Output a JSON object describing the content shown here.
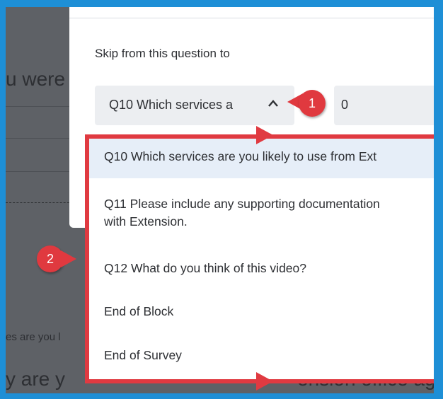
{
  "background": {
    "snippet_top": "u were",
    "snippet_middle": "es are you l",
    "snippet_bottom": "y are y",
    "snippet_bottom_right": "ension office aga"
  },
  "modal": {
    "skip_label": "Skip from this question to",
    "select_value": "Q10 Which services a",
    "second_field_value": "0"
  },
  "dropdown": {
    "items": [
      {
        "label": "Q10 Which services are you likely to use from Ext"
      },
      {
        "label": "Q11 Please include any supporting documentation",
        "label_line2": "with Extension."
      },
      {
        "label": "Q12 What do you think of this video?"
      },
      {
        "label": "End of Block"
      },
      {
        "label": "End of Survey"
      }
    ]
  },
  "annotations": {
    "badge_1": "1",
    "badge_2": "2",
    "accent_color": "#e0393f",
    "border_color": "#1e8fd6"
  }
}
